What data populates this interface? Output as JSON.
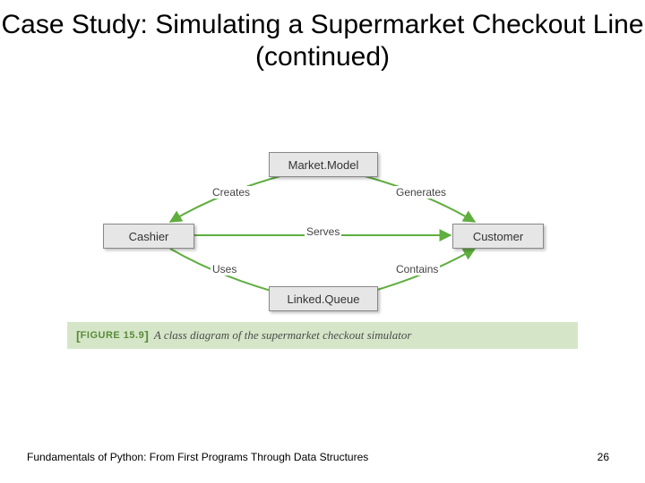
{
  "title": "Case Study: Simulating a Supermarket Checkout Line (continued)",
  "diagram": {
    "nodes": {
      "market": "Market.Model",
      "cashier": "Cashier",
      "customer": "Customer",
      "queue": "Linked.Queue"
    },
    "edges": {
      "creates": "Creates",
      "generates": "Generates",
      "serves": "Serves",
      "uses": "Uses",
      "contains": "Contains"
    }
  },
  "figure": {
    "label": "FIGURE 15.9",
    "caption": "A class diagram of the supermarket checkout simulator"
  },
  "footer": {
    "book": "Fundamentals of Python: From First Programs Through Data Structures",
    "page": "26"
  },
  "colors": {
    "caption_bg": "#d5e6c8",
    "caption_accent": "#5a8a3a",
    "node_bg": "#e6e6e6",
    "arrow": "#5fae3f"
  }
}
